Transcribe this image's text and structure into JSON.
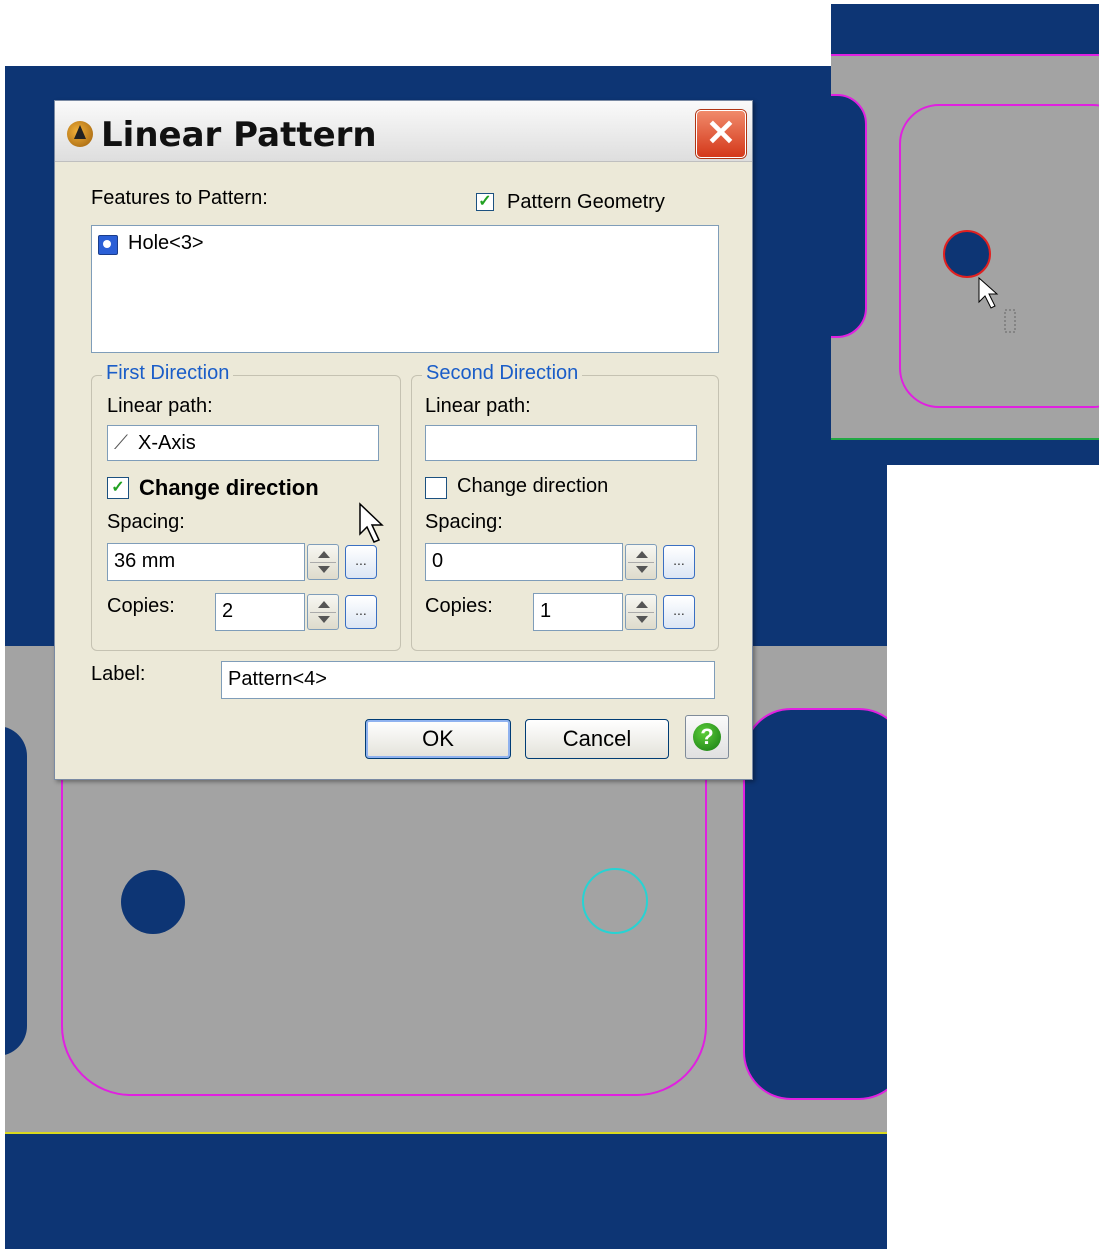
{
  "dialog": {
    "title": "Linear Pattern",
    "close_label": "✕",
    "features_label": "Features to Pattern:",
    "pattern_geometry": {
      "label": "Pattern Geometry",
      "checked": true
    },
    "features_list": [
      "Hole<3>"
    ],
    "first_direction": {
      "title": "First Direction",
      "linear_path_label": "Linear path:",
      "linear_path_value": "X-Axis",
      "change_direction_label": "Change direction",
      "change_direction_checked": true,
      "spacing_label": "Spacing:",
      "spacing_value": "36 mm",
      "copies_label": "Copies:",
      "copies_value": "2",
      "dots_label": "..."
    },
    "second_direction": {
      "title": "Second Direction",
      "linear_path_label": "Linear path:",
      "linear_path_value": "",
      "change_direction_label": "Change direction",
      "change_direction_checked": false,
      "spacing_label": "Spacing:",
      "spacing_value": "0",
      "copies_label": "Copies:",
      "copies_value": "1",
      "dots_label": "..."
    },
    "label_label": "Label:",
    "label_value": "Pattern<4>",
    "ok_label": "OK",
    "cancel_label": "Cancel",
    "help_label": "?"
  },
  "colors": {
    "viewport_bg": "#0d3574",
    "plate": "#a3a3a3",
    "pocket_outline": "#e020e0",
    "preview_hole": "#27d3d3",
    "selected_hole": "#e02020",
    "accent": "#1a5dc8"
  }
}
